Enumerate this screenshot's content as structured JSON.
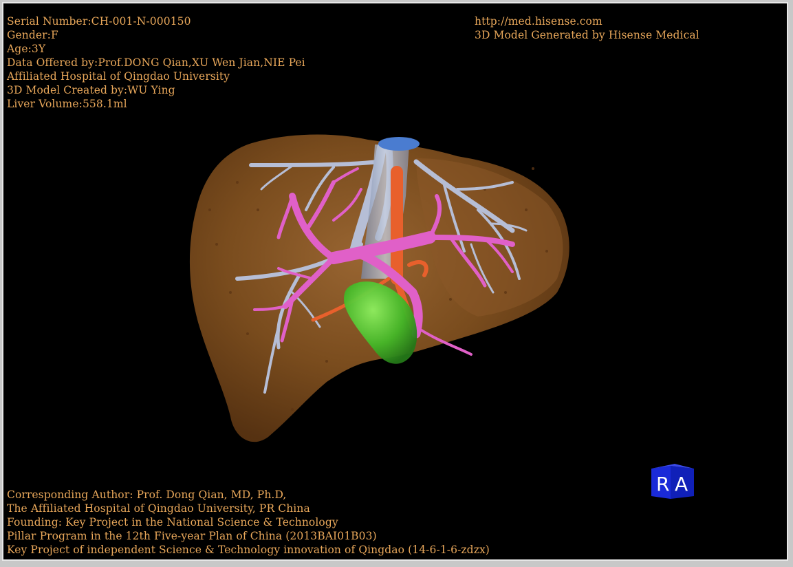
{
  "header_left": {
    "serial": "Serial Number:CH-001-N-000150",
    "gender": "Gender:F",
    "age": "Age:3Y",
    "data_offered": "Data Offered by:Prof.DONG Qian,XU Wen Jian,NIE Pei",
    "hospital": "Affiliated Hospital of Qingdao University",
    "created_by": "3D Model Created by:WU Ying",
    "liver_volume": "Liver Volume:558.1ml"
  },
  "header_right": {
    "url": "http://med.hisense.com",
    "generated_by": "3D Model Generated by Hisense Medical"
  },
  "footer": {
    "author": "Corresponding Author: Prof. Dong Qian, MD, Ph.D,",
    "affiliation": "The Affiliated Hospital of Qingdao University, PR China",
    "founding": "Founding: Key Project in the National Science & Technology",
    "program": "Pillar Program in the 12th Five-year Plan of China (2013BAI01B03)",
    "key_project": "Key Project of independent Science & Technology innovation of Qingdao (14-6-1-6-zdzx)"
  },
  "orientation_cube": {
    "left_face": "R",
    "front_face": "A"
  },
  "colors": {
    "background": "#000000",
    "text": "#e8a75a",
    "liver": "#7a4a1c",
    "portal_vein": "#e060c8",
    "hepatic_vein": "#b8c0d8",
    "artery": "#e8602c",
    "gallbladder": "#44c028",
    "ivc_top": "#4a7cd0",
    "cube": "#1a2ad8"
  },
  "scene_labels": {
    "model": "3d-liver-model"
  }
}
